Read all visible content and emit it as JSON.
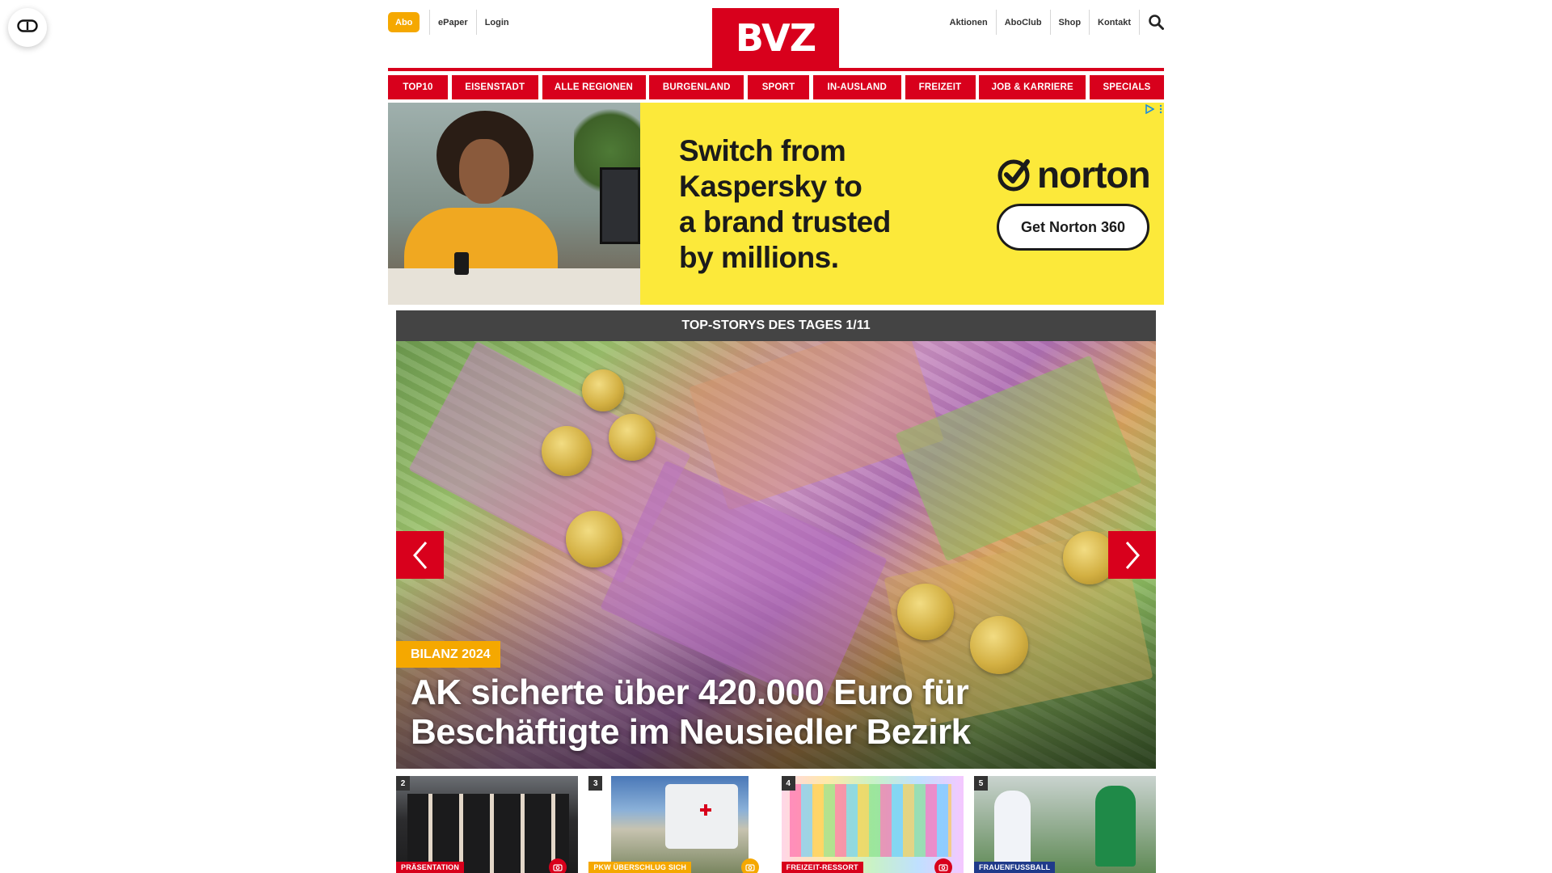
{
  "header": {
    "abo_label": "Abo",
    "left_links": [
      "ePaper",
      "Login"
    ],
    "right_links": [
      "Aktionen",
      "AboClub",
      "Shop",
      "Kontakt"
    ],
    "logo_text": "BVZ",
    "search_icon": "search-icon",
    "accessibility_icon": "accessibility-toggle-icon"
  },
  "nav": {
    "items": [
      "TOP10",
      "EISENSTADT",
      "ALLE REGIONEN",
      "BURGENLAND",
      "SPORT",
      "IN-AUSLAND",
      "FREIZEIT",
      "JOB & KARRIERE",
      "SPECIALS"
    ]
  },
  "ad": {
    "headline_lines": [
      "Switch from",
      "Kaspersky to",
      "a brand trusted",
      "by millions."
    ],
    "brand": "norton",
    "cta": "Get Norton 360",
    "ad_choices_icons": [
      "adchoices-icon",
      "more-icon"
    ],
    "colors": {
      "background": "#fce93a"
    }
  },
  "top_stories": {
    "heading": "TOP-STORYS DES TAGES 1/11",
    "hero": {
      "kicker": "BILANZ 2024",
      "headline": "AK sicherte über 420.000 Euro für Beschäftigte im Neusiedler Bezirk",
      "prev_icon": "chevron-left-icon",
      "next_icon": "chevron-right-icon"
    },
    "thumbnails": [
      {
        "number": "2",
        "label": "PRÄSENTATION",
        "camera": true
      },
      {
        "number": "3",
        "label": "PKW ÜBERSCHLUG SICH",
        "camera": true
      },
      {
        "number": "4",
        "label": "FREIZEIT-RESSORT",
        "camera": true
      },
      {
        "number": "5",
        "label": "FRAUENFUSSBALL",
        "camera": false
      }
    ]
  },
  "colors": {
    "brand_red": "#d8001c",
    "accent_yellow": "#f5a800",
    "header_bar": "#444444"
  }
}
